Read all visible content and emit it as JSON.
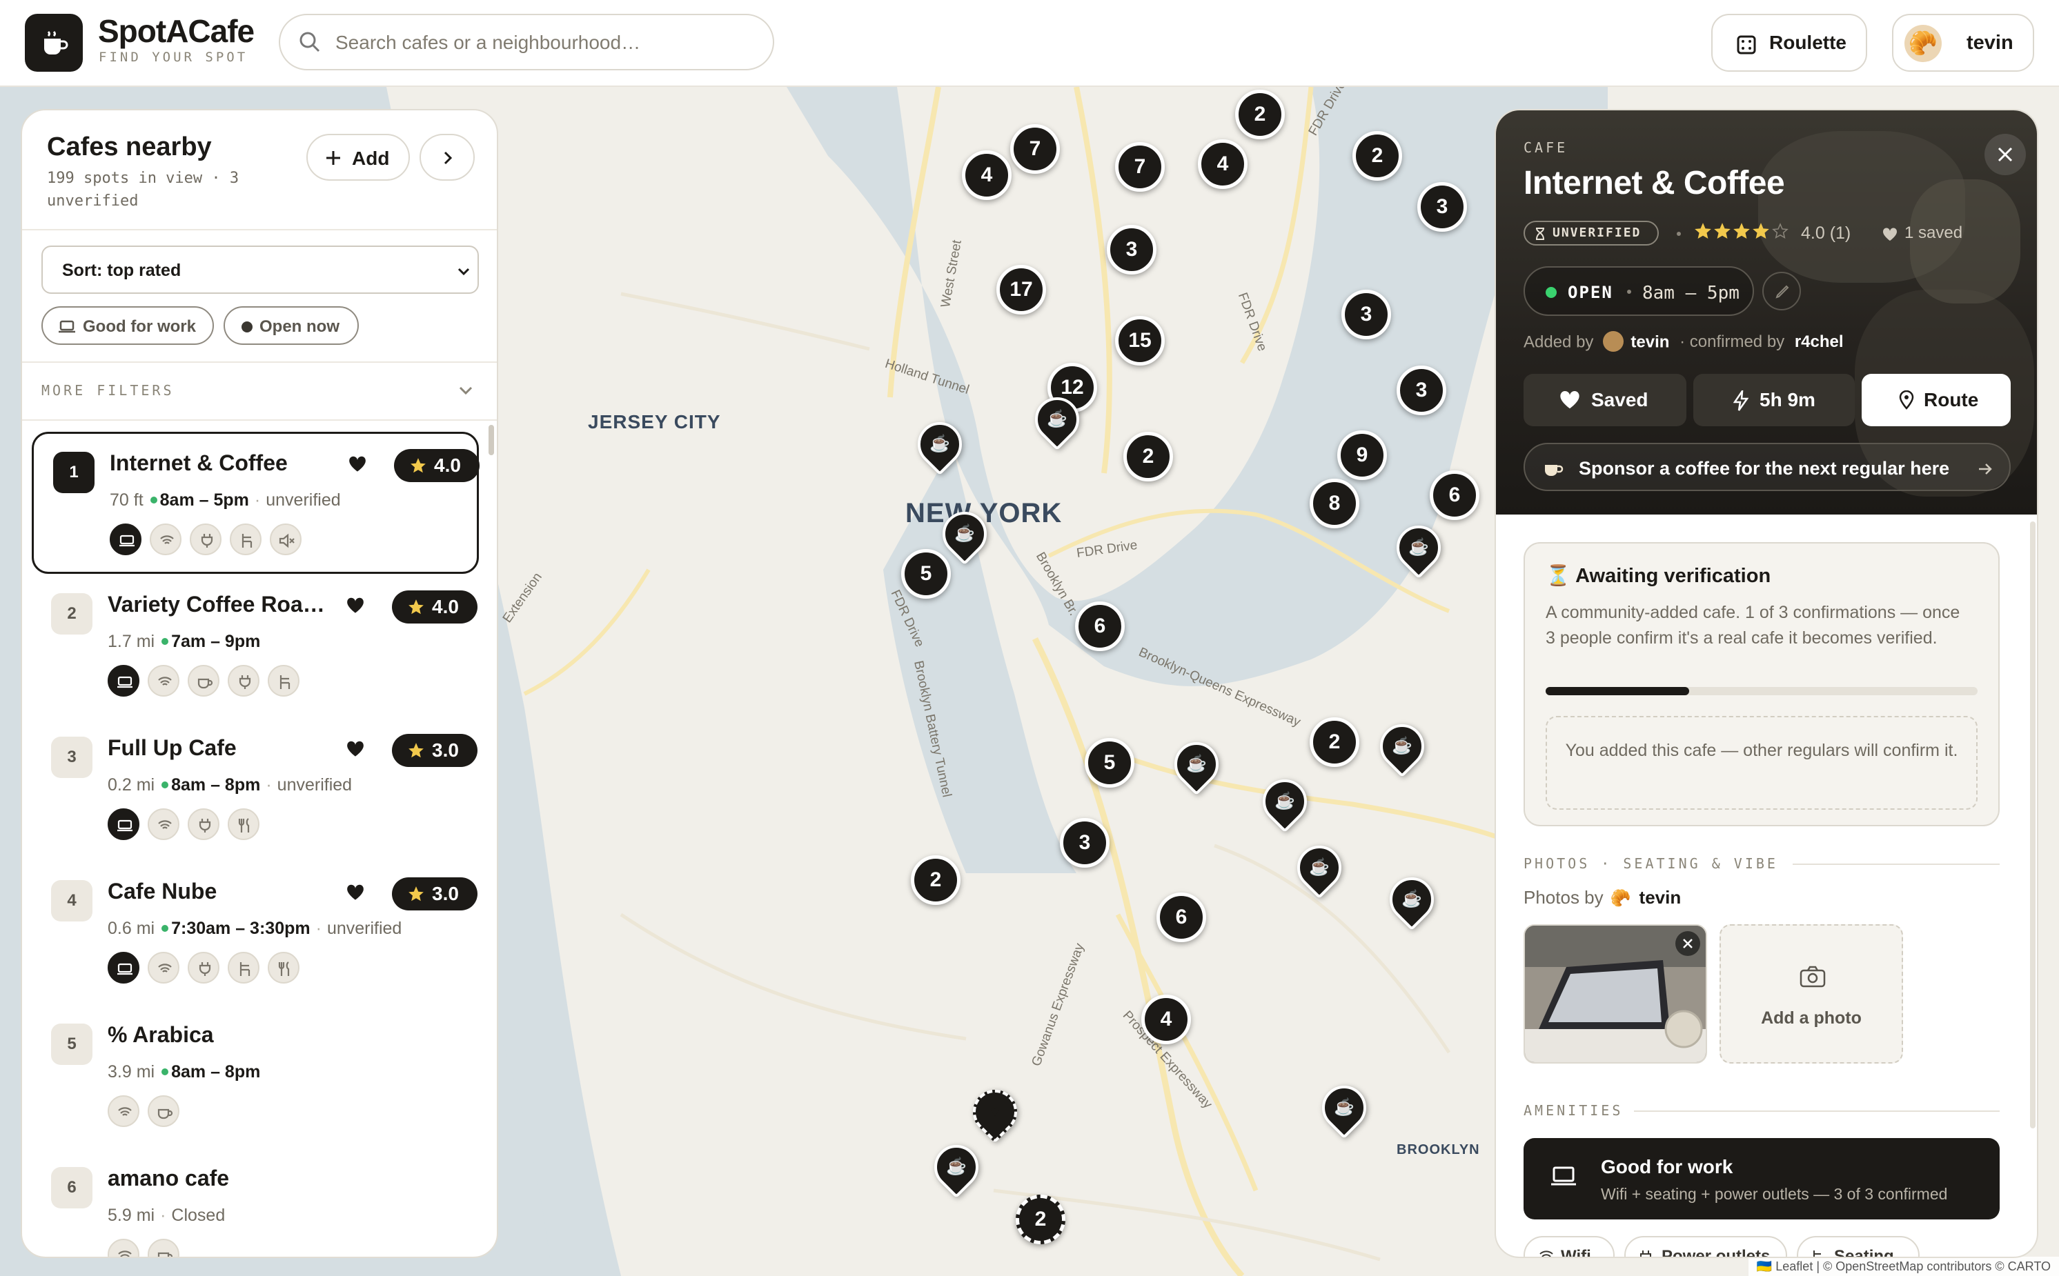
{
  "header": {
    "brand": "SpotACafe",
    "tagline": "FIND YOUR SPOT",
    "search_placeholder": "Search cafes or a neighbourhood…",
    "roulette_label": "Roulette",
    "user_name": "tevin",
    "user_avatar": "🥐"
  },
  "map": {
    "place_labels": [
      "JERSEY CITY",
      "NEW YORK",
      "BROOKLYN"
    ],
    "street_labels": [
      "West Street",
      "Holland Tunnel",
      "FDR Drive",
      "FDR Drive",
      "Brooklyn Br.",
      "FDR Drive",
      "Brooklyn Battery Tunnel",
      "Brooklyn-Queens Expressway",
      "Gowanus Expressway",
      "Prospect Expressway",
      "Extension",
      "FDR Drive"
    ],
    "cluster_counts": [
      "2",
      "7",
      "4",
      "7",
      "4",
      "2",
      "3",
      "3",
      "3",
      "17",
      "15",
      "12",
      "3",
      "2",
      "9",
      "8",
      "6",
      "5",
      "6",
      "5",
      "2",
      "3",
      "2",
      "6",
      "4",
      "2"
    ],
    "cafe_pin_icon": "coffee-cup-icon",
    "attribution": "🇺🇦 Leaflet | © OpenStreetMap contributors © CARTO"
  },
  "sidebar": {
    "title": "Cafes nearby",
    "subtitle": "199 spots in view · 3 unverified",
    "add_label": "Add",
    "sort_label": "Sort: top rated",
    "filter_chips": [
      {
        "label": "Good for work",
        "icon": "laptop-icon"
      },
      {
        "label": "Open now",
        "icon": "dot-icon"
      }
    ],
    "more_filters_label": "MORE FILTERS",
    "cafes": [
      {
        "num": "1",
        "name": "Internet & Coffee",
        "rating": "4.0",
        "distance": "70 ft",
        "hours": "8am – 5pm",
        "status": "unverified",
        "amenities": [
          "laptop",
          "wifi",
          "plug",
          "chair",
          "mute"
        ],
        "favorited": true
      },
      {
        "num": "2",
        "name": "Variety Coffee Roasters",
        "rating": "4.0",
        "distance": "1.7 mi",
        "hours": "7am – 9pm",
        "status": "",
        "amenities": [
          "laptop",
          "wifi",
          "cup",
          "plug",
          "chair"
        ],
        "favorited": true
      },
      {
        "num": "3",
        "name": "Full Up Cafe",
        "rating": "3.0",
        "distance": "0.2 mi",
        "hours": "8am – 8pm",
        "status": "unverified",
        "amenities": [
          "laptop",
          "wifi",
          "plug",
          "food"
        ],
        "favorited": true
      },
      {
        "num": "4",
        "name": "Cafe Nube",
        "rating": "3.0",
        "distance": "0.6 mi",
        "hours": "7:30am – 3:30pm",
        "status": "unverified",
        "amenities": [
          "laptop",
          "wifi",
          "plug",
          "chair",
          "food"
        ],
        "favorited": true
      },
      {
        "num": "5",
        "name": "% Arabica",
        "rating": "",
        "distance": "3.9 mi",
        "hours": "8am – 8pm",
        "status": "",
        "amenities": [
          "wifi",
          "cup"
        ],
        "favorited": false
      },
      {
        "num": "6",
        "name": "amano cafe",
        "rating": "",
        "distance": "5.9 mi",
        "hours": "",
        "status": "Closed",
        "amenities": [
          "wifi",
          "cup"
        ],
        "favorited": false
      }
    ]
  },
  "detail": {
    "kicker": "CAFE",
    "title": "Internet & Coffee",
    "badge": "UNVERIFIED",
    "stars": 4,
    "rating_text": "4.0 (1)",
    "saved_count": "1 saved",
    "open_label": "OPEN",
    "hours": "8am – 5pm",
    "added_by_prefix": "Added by",
    "added_by_user": "tevin",
    "confirmed_prefix": "· confirmed by",
    "confirmed_user": "r4chel",
    "saved_btn": "Saved",
    "time_btn": "5h 9m",
    "route_btn": "Route",
    "sponsor_text": "Sponsor a coffee for the next regular here",
    "awaiting_title": "⏳ Awaiting verification",
    "awaiting_text": "A community-added cafe. 1 of 3 confirmations — once 3 people confirm it's a real cafe it becomes verified.",
    "awaiting_progress": 0.333,
    "awaiting_note": "You added this cafe — other regulars will confirm it.",
    "photos_heading": "PHOTOS · SEATING & VIBE",
    "photos_by_prefix": "Photos by",
    "photos_by_emoji": "🥐",
    "photos_by_user": "tevin",
    "add_photo_label": "Add a photo",
    "amenities_heading": "AMENITIES",
    "good_for_work_title": "Good for work",
    "good_for_work_sub": "Wifi + seating + power outlets — 3 of 3 confirmed",
    "amenity_chips": [
      "Wifi",
      "Power outlets",
      "Seating"
    ]
  },
  "colors": {
    "ink": "#1c1a17",
    "open_green": "#3ab36a",
    "star": "#f2c94c",
    "map_water": "#d5dee2",
    "map_land": "#f1efe9"
  }
}
